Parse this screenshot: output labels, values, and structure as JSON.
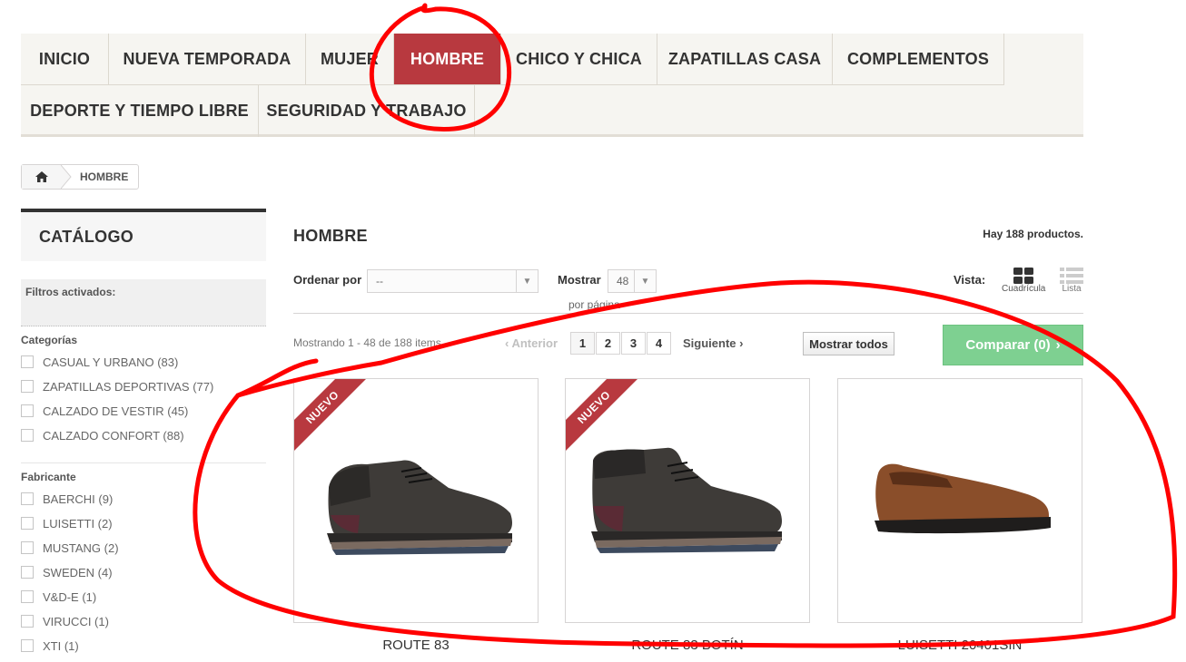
{
  "menu": {
    "items": [
      {
        "label": "INICIO"
      },
      {
        "label": "NUEVA TEMPORADA"
      },
      {
        "label": "MUJER"
      },
      {
        "label": "HOMBRE",
        "active": true
      },
      {
        "label": "CHICO Y CHICA"
      },
      {
        "label": "ZAPATILLAS CASA"
      },
      {
        "label": "COMPLEMENTOS"
      },
      {
        "label": "DEPORTE Y TIEMPO LIBRE"
      },
      {
        "label": "SEGURIDAD Y TRABAJO"
      }
    ]
  },
  "breadcrumb": {
    "home_icon": "home-icon",
    "current": "HOMBRE"
  },
  "sidebar": {
    "title": "CATÁLOGO",
    "active_filters_label": "Filtros activados:",
    "categories_title": "Categorías",
    "categories": [
      {
        "label": "CASUAL Y URBANO (83)"
      },
      {
        "label": "ZAPATILLAS DEPORTIVAS (77)"
      },
      {
        "label": "CALZADO DE VESTIR (45)"
      },
      {
        "label": "CALZADO CONFORT (88)"
      }
    ],
    "manufacturer_title": "Fabricante",
    "manufacturers": [
      {
        "label": "BAERCHI (9)"
      },
      {
        "label": "LUISETTI (2)"
      },
      {
        "label": "MUSTANG (2)"
      },
      {
        "label": "SWEDEN (4)"
      },
      {
        "label": "V&D-E (1)"
      },
      {
        "label": "VIRUCCI (1)"
      },
      {
        "label": "XTI (1)"
      }
    ]
  },
  "main": {
    "heading": "HOMBRE",
    "product_count": "Hay 188 productos.",
    "sort_label": "Ordenar por",
    "sort_value": "--",
    "show_label": "Mostrar",
    "show_value": "48",
    "per_page_label": "por página",
    "view_label": "Vista:",
    "view_grid_label": "Cuadrícula",
    "view_list_label": "Lista",
    "showing_text": "Mostrando 1 - 48 de 188 items",
    "prev_label": "Anterior",
    "pages": [
      "1",
      "2",
      "3",
      "4"
    ],
    "current_page": "1",
    "next_label": "Siguiente",
    "show_all_label": "Mostrar todos",
    "compare_label": "Comparar (0)"
  },
  "products": [
    {
      "name": "ROUTE 83",
      "badge": "NUEVO"
    },
    {
      "name": "ROUTE 83 BOTÍN",
      "badge": "NUEVO"
    },
    {
      "name": "LUISETTI 20401SIN",
      "badge": ""
    }
  ],
  "colors": {
    "accent": "#b8393f",
    "compare": "#7ed091",
    "annotation": "#ff0000"
  }
}
